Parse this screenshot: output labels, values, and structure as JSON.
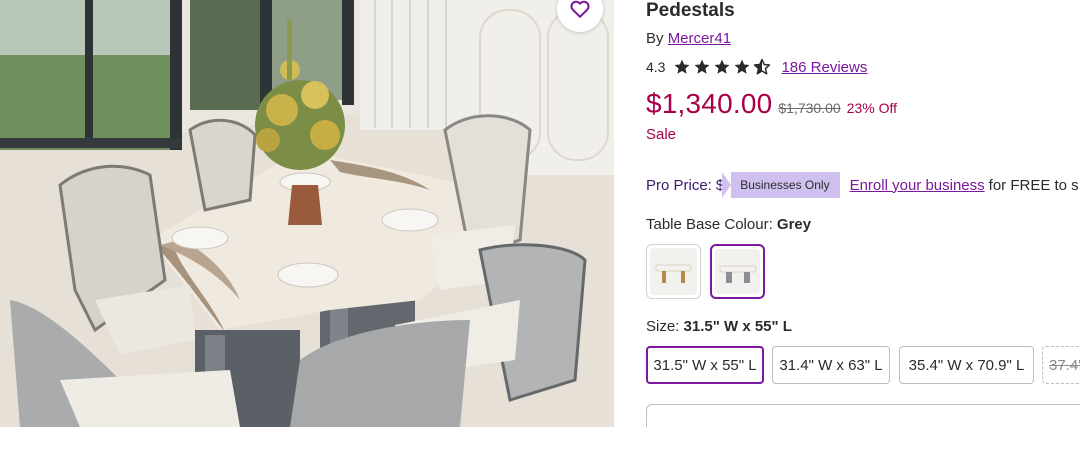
{
  "product": {
    "title": "Pedestals",
    "by_prefix": "By",
    "brand": "Mercer41",
    "rating_value": "4.3",
    "rating_stars": 4.3,
    "reviews_link": "186 Reviews",
    "price": "$1,340.00",
    "original_price": "$1,730.00",
    "discount": "23% Off",
    "sale_label": "Sale"
  },
  "pro_price": {
    "label": "Pro Price:",
    "amount": "$",
    "badge": "Businesses Only",
    "enroll_link": "Enroll your business",
    "enroll_rest": "for FREE to s"
  },
  "base_colour": {
    "label": "Table Base Colour:",
    "selected": "Grey",
    "options": [
      {
        "name": "gold-base-swatch",
        "selected": false
      },
      {
        "name": "grey-base-swatch",
        "selected": true
      }
    ]
  },
  "size": {
    "label": "Size:",
    "selected": "31.5\" W x 55\" L",
    "options": [
      {
        "label": "31.5\" W x 55\" L",
        "state": "selected"
      },
      {
        "label": "31.4\" W x 63\" L",
        "state": "available"
      },
      {
        "label": "35.4\" W x 70.9\" L",
        "state": "available"
      },
      {
        "label": "37.4\"",
        "state": "unavailable"
      }
    ]
  },
  "icons": {
    "favorite": "heart-icon",
    "star": "star-icon"
  },
  "colors": {
    "accent_purple": "#7b189f",
    "price_red": "#a8004a",
    "badge_lavender": "#cfc0f0",
    "pro_text": "#3d1a6b"
  }
}
